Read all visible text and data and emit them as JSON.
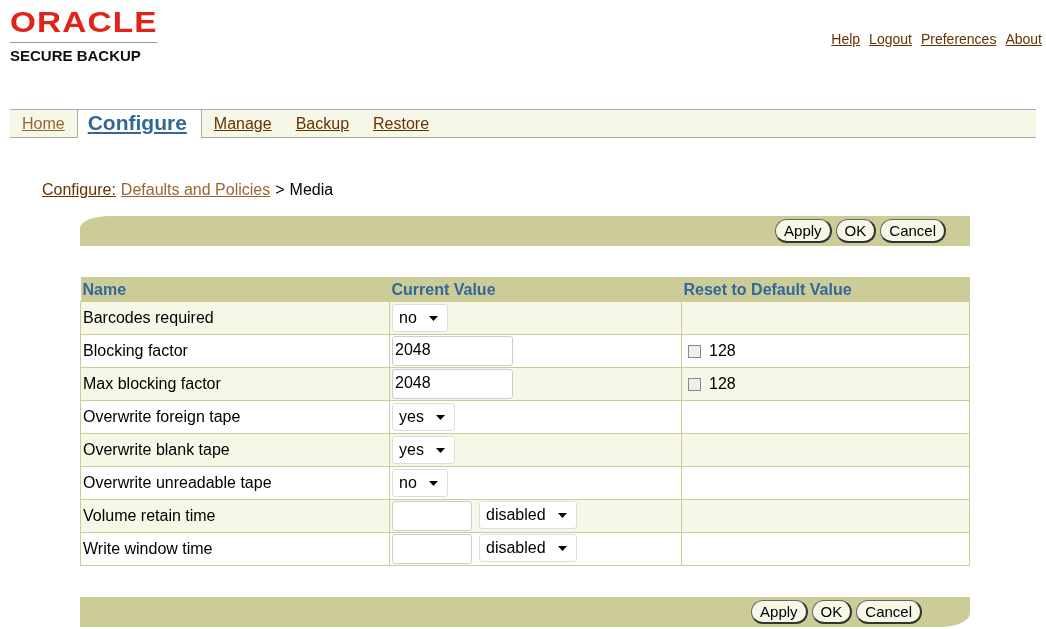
{
  "logo": {
    "brand": "ORACLE",
    "product": "SECURE BACKUP"
  },
  "global_links": [
    "Help",
    "Logout",
    "Preferences",
    "About"
  ],
  "tabs": [
    {
      "label": "Home",
      "selected": false
    },
    {
      "label": "Configure",
      "selected": true
    },
    {
      "label": "Manage",
      "selected": false
    },
    {
      "label": "Backup",
      "selected": false
    },
    {
      "label": "Restore",
      "selected": false
    }
  ],
  "breadcrumb": {
    "section": "Configure:",
    "link": "Defaults and Policies",
    "separator": ">",
    "current": "Media"
  },
  "top_buttons": [
    "Apply",
    "OK",
    "Cancel"
  ],
  "table": {
    "columns": [
      "Name",
      "Current Value",
      "Reset to Default Value"
    ],
    "rows": [
      {
        "name": "Barcodes required",
        "kind": "select",
        "value": "no"
      },
      {
        "name": "Blocking factor",
        "kind": "text",
        "value": "2048",
        "reset": {
          "checked": false,
          "label": "128"
        }
      },
      {
        "name": "Max blocking factor",
        "kind": "text",
        "value": "2048",
        "reset": {
          "checked": false,
          "label": "128"
        }
      },
      {
        "name": "Overwrite foreign tape",
        "kind": "select",
        "value": "yes"
      },
      {
        "name": "Overwrite blank tape",
        "kind": "select",
        "value": "yes"
      },
      {
        "name": "Overwrite unreadable tape",
        "kind": "select",
        "value": "no"
      },
      {
        "name": "Volume retain time",
        "kind": "text-select",
        "value": "disabled"
      },
      {
        "name": "Write window time",
        "kind": "text-select",
        "value": "disabled"
      }
    ]
  },
  "bottom_buttons": [
    "Apply",
    "OK",
    "Cancel"
  ]
}
